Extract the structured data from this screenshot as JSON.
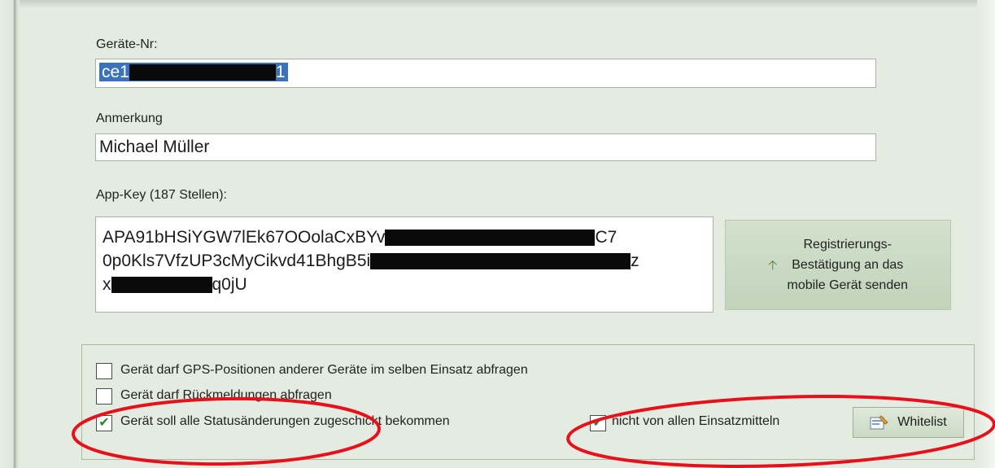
{
  "form": {
    "device_no_label": "Geräte-Nr:",
    "device_no_prefix": "ce1",
    "device_no_suffix": "1",
    "remark_label": "Anmerkung",
    "remark_value": "Michael Müller",
    "appkey_label": "App-Key (187 Stellen):",
    "appkey_line1_start": "APA91bHSiYGW7lEk67OOolaCxBYv",
    "appkey_line1_end": "C7",
    "appkey_line2_start": "0p0Kls7VfzUP3cMyCikvd41BhgB5i",
    "appkey_line2_end": "z",
    "appkey_line3_start": "x",
    "appkey_line3_end": "q0jU",
    "register_button": {
      "line1": "Registrierungs-",
      "line2": "Bestätigung an das",
      "line3": "mobile Gerät senden",
      "icon": "arrow-up-icon"
    }
  },
  "options": {
    "gps_query": {
      "label": "Gerät darf GPS-Positionen anderer Geräte im selben Einsatz abfragen",
      "checked": false
    },
    "feedback_query": {
      "label": "Gerät darf Rückmeldungen abfragen",
      "checked": false
    },
    "status_changes": {
      "label": "Gerät soll alle Statusänderungen zugeschickt bekommen",
      "checked": true
    },
    "not_all_units": {
      "label": "nicht von allen Einsatzmitteln",
      "checked": true
    },
    "whitelist_button": "Whitelist"
  },
  "colors": {
    "selection": "#3b73b9",
    "annotation": "#e8101a",
    "check": "#2b8a2b"
  }
}
